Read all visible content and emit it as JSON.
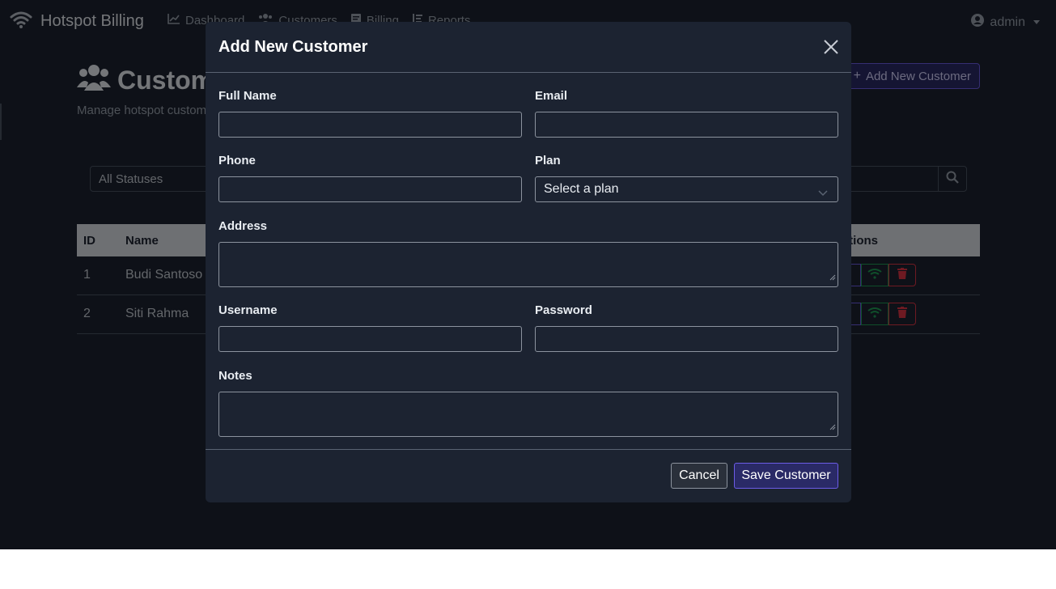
{
  "navbar": {
    "brand": "Hotspot Billing",
    "links": [
      {
        "label": "Dashboard",
        "icon": "chart-line-icon"
      },
      {
        "label": "Customers",
        "icon": "users-icon"
      },
      {
        "label": "Billing",
        "icon": "receipt-icon"
      },
      {
        "label": "Reports",
        "icon": "list-icon"
      }
    ],
    "user": "admin"
  },
  "page": {
    "title": "Customers",
    "subtitle": "Manage hotspot customers",
    "add_button": "Add New Customer"
  },
  "filters": {
    "status_selected": "All Statuses"
  },
  "table": {
    "headers": [
      "ID",
      "Name",
      "Actions"
    ],
    "rows": [
      {
        "id": "1",
        "name": "Budi Santoso"
      },
      {
        "id": "2",
        "name": "Siti Rahma"
      }
    ]
  },
  "modal": {
    "title": "Add New Customer",
    "fields": {
      "full_name": {
        "label": "Full Name",
        "value": ""
      },
      "email": {
        "label": "Email",
        "value": ""
      },
      "phone": {
        "label": "Phone",
        "value": ""
      },
      "plan": {
        "label": "Plan",
        "selected": "Select a plan"
      },
      "address": {
        "label": "Address",
        "value": ""
      },
      "username": {
        "label": "Username",
        "value": ""
      },
      "password": {
        "label": "Password",
        "value": ""
      },
      "notes": {
        "label": "Notes",
        "value": ""
      }
    },
    "cancel_label": "Cancel",
    "save_label": "Save Customer"
  },
  "colors": {
    "background": "#1c2331",
    "accent": "#6c5ce7",
    "success": "#1f9d55",
    "danger": "#dc3545"
  }
}
